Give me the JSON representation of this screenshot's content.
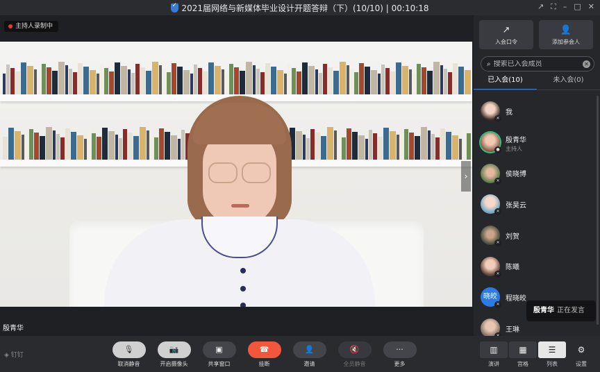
{
  "window": {
    "title": "2021届网络与新媒体毕业设计开题答辩（下）(10/10) | 00:10:18",
    "controls": [
      "↗",
      "⛶",
      "–",
      "□",
      "✕"
    ]
  },
  "video": {
    "recording_badge": "主持人录制中",
    "speaker_name": "殷青华"
  },
  "panel": {
    "buttons": [
      {
        "icon": "↗",
        "label": "入会口令"
      },
      {
        "icon": "👤",
        "label": "添加参会人"
      }
    ],
    "search_placeholder": "搜索已入会成员",
    "tabs": [
      {
        "label": "已入会(10)",
        "active": true
      },
      {
        "label": "未入会(0)",
        "active": false
      }
    ],
    "members": [
      {
        "name": "我",
        "role": ""
      },
      {
        "name": "殷青华",
        "role": "主持人"
      },
      {
        "name": "侯晓博",
        "role": ""
      },
      {
        "name": "张昊云",
        "role": ""
      },
      {
        "name": "刘贺",
        "role": ""
      },
      {
        "name": "陈曦",
        "role": ""
      },
      {
        "name": "程晓皎",
        "role": "",
        "avatar_text": "晓皎"
      },
      {
        "name": "王琳",
        "role": ""
      }
    ],
    "toast": {
      "name": "殷青华",
      "status": "正在发言"
    }
  },
  "toolbar": {
    "logo": "钉钉",
    "tools": [
      {
        "label": "取消静音",
        "icon": "🎙"
      },
      {
        "label": "开启摄像头",
        "icon": "📷"
      },
      {
        "label": "共享窗口",
        "icon": "▣"
      },
      {
        "label": "挂断",
        "icon": "☎"
      },
      {
        "label": "邀请",
        "icon": "👤"
      },
      {
        "label": "全员静音",
        "icon": "🔇"
      },
      {
        "label": "更多",
        "icon": "···"
      }
    ],
    "views": [
      {
        "label": "演讲",
        "icon": "▥"
      },
      {
        "label": "宫格",
        "icon": "▦"
      },
      {
        "label": "列表",
        "icon": "☰"
      },
      {
        "label": "设置",
        "icon": "⚙"
      }
    ]
  },
  "colors": {
    "accent": "#3a7bd5",
    "hangup": "#f2563b",
    "host_ring": "#2ec27e"
  }
}
